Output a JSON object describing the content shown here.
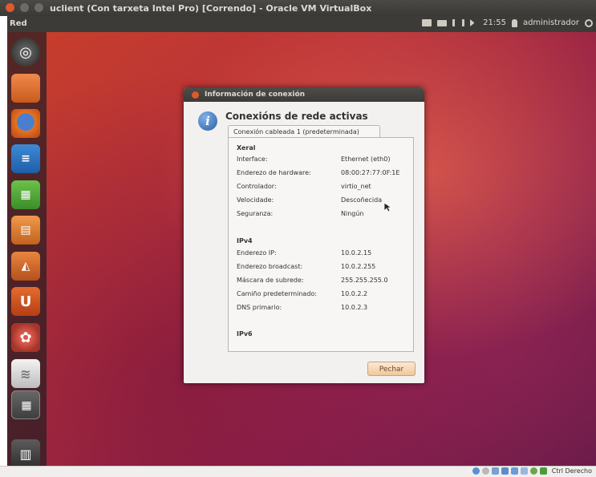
{
  "vbox": {
    "title": "uclient (Con tarxeta Intel Pro) [Correndo] - Oracle VM VirtualBox",
    "host_key": "Ctrl Derecho"
  },
  "top_panel": {
    "app_name": "Red",
    "clock": "21:55",
    "user": "administrador"
  },
  "launcher": {
    "items": [
      "dash-home",
      "files",
      "firefox",
      "writer",
      "calc",
      "impress",
      "software-center",
      "ubuntu-one",
      "system-settings",
      "network",
      "workspace-switcher",
      "trash"
    ]
  },
  "dialog": {
    "title": "Información de conexión",
    "heading": "Conexións de rede activas",
    "tab": "Conexión cableada 1 (predeterminada)",
    "sections": [
      {
        "name": "Xeral",
        "rows": [
          {
            "label": "Interface:",
            "value": "Ethernet (eth0)"
          },
          {
            "label": "Enderezo de hardware:",
            "value": "08:00:27:77:0F:1E"
          },
          {
            "label": "Controlador:",
            "value": "virtio_net"
          },
          {
            "label": "Velocidade:",
            "value": "Descoñecida"
          },
          {
            "label": "Seguranza:",
            "value": "Ningún"
          }
        ]
      },
      {
        "name": "IPv4",
        "rows": [
          {
            "label": "Enderezo IP:",
            "value": "10.0.2.15"
          },
          {
            "label": "Enderezo broadcast:",
            "value": "10.0.2.255"
          },
          {
            "label": "Máscara de subrede:",
            "value": "255.255.255.0"
          },
          {
            "label": "Camiño predeterminado:",
            "value": "10.0.2.2"
          },
          {
            "label": "DNS primario:",
            "value": "10.0.2.3"
          }
        ]
      },
      {
        "name": "IPv6",
        "rows": []
      }
    ],
    "close_button": "Pechar"
  },
  "colors": {
    "panel": "#3c3b37",
    "accent_orange": "#df5a2c",
    "desktop_red": "#b93339",
    "desktop_purple": "#5e1845"
  }
}
